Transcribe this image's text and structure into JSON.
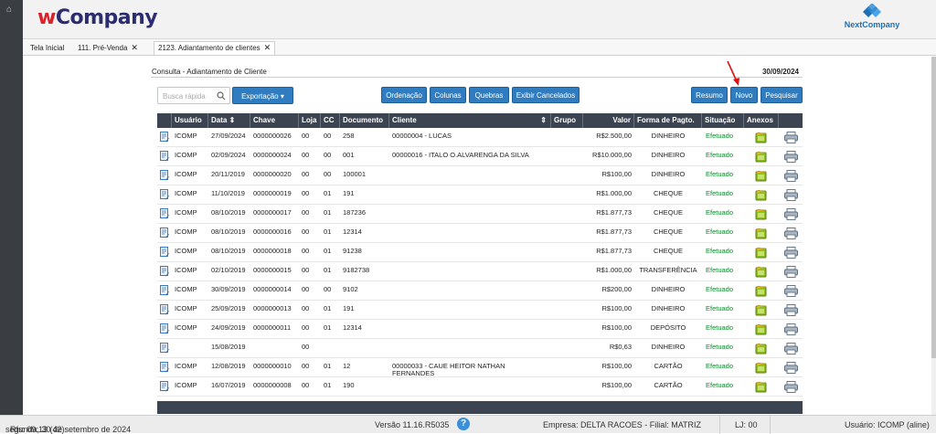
{
  "app": {
    "brand_w": "w",
    "brand_rest": "Company",
    "partner": "NextCompany"
  },
  "tabs": [
    {
      "label": "Tela Inicial",
      "closable": false
    },
    {
      "label": "111. Pré-Venda",
      "closable": true
    },
    {
      "label": "2123. Adiantamento de clientes",
      "closable": true,
      "active": true
    }
  ],
  "panel": {
    "title": "Consulta - Adiantamento de Cliente",
    "date": "30/09/2024"
  },
  "toolbar": {
    "search_placeholder": "Busca rápida",
    "export": "Exportação",
    "order": "Ordenação",
    "columns": "Colunas",
    "breaks": "Quebras",
    "show_cancelled": "Exibir Cancelados",
    "summary": "Resumo",
    "new": "Novo",
    "search": "Pesquisar"
  },
  "columns": [
    "Usuário",
    "Data",
    "Chave",
    "Loja",
    "CC",
    "Documento",
    "Cliente",
    "Grupo",
    "Valor",
    "Forma de Pagto.",
    "Situação",
    "Anexos"
  ],
  "rows": [
    {
      "user": "ICOMP",
      "date": "27/09/2024",
      "key": "0000000026",
      "store": "00",
      "cc": "00",
      "doc": "258",
      "client": "00000004 - LUCAS",
      "client2": "",
      "value": "R$2.500,00",
      "pay": "DINHEIRO",
      "status": "Efetuado"
    },
    {
      "user": "ICOMP",
      "date": "02/09/2024",
      "key": "0000000024",
      "store": "00",
      "cc": "00",
      "doc": "001",
      "client": "00000016 - ITALO O.ALVARENGA DA SILVA",
      "client2": "",
      "value": "R$10.000,00",
      "pay": "DINHEIRO",
      "status": "Efetuado"
    },
    {
      "user": "ICOMP",
      "date": "20/11/2019",
      "key": "0000000020",
      "store": "00",
      "cc": "00",
      "doc": "100001",
      "client": "",
      "client2": "",
      "value": "R$100,00",
      "pay": "DINHEIRO",
      "status": "Efetuado"
    },
    {
      "user": "ICOMP",
      "date": "11/10/2019",
      "key": "0000000019",
      "store": "00",
      "cc": "01",
      "doc": "191",
      "client": "",
      "client2": "",
      "value": "R$1.000,00",
      "pay": "CHEQUE",
      "status": "Efetuado"
    },
    {
      "user": "ICOMP",
      "date": "08/10/2019",
      "key": "0000000017",
      "store": "00",
      "cc": "01",
      "doc": "187236",
      "client": "",
      "client2": "",
      "value": "R$1.877,73",
      "pay": "CHEQUE",
      "status": "Efetuado"
    },
    {
      "user": "ICOMP",
      "date": "08/10/2019",
      "key": "0000000016",
      "store": "00",
      "cc": "01",
      "doc": "12314",
      "client": "",
      "client2": "",
      "value": "R$1.877,73",
      "pay": "CHEQUE",
      "status": "Efetuado"
    },
    {
      "user": "ICOMP",
      "date": "08/10/2019",
      "key": "0000000018",
      "store": "00",
      "cc": "01",
      "doc": "91238",
      "client": "",
      "client2": "",
      "value": "R$1.877,73",
      "pay": "CHEQUE",
      "status": "Efetuado"
    },
    {
      "user": "ICOMP",
      "date": "02/10/2019",
      "key": "0000000015",
      "store": "00",
      "cc": "01",
      "doc": "9182738",
      "client": "",
      "client2": "",
      "value": "R$1.000,00",
      "pay": "TRANSFERÊNCIA",
      "status": "Efetuado"
    },
    {
      "user": "ICOMP",
      "date": "30/09/2019",
      "key": "0000000014",
      "store": "00",
      "cc": "00",
      "doc": "9102",
      "client": "",
      "client2": "",
      "value": "R$200,00",
      "pay": "DINHEIRO",
      "status": "Efetuado"
    },
    {
      "user": "ICOMP",
      "date": "25/09/2019",
      "key": "0000000013",
      "store": "00",
      "cc": "01",
      "doc": "191",
      "client": "",
      "client2": "",
      "value": "R$100,00",
      "pay": "DINHEIRO",
      "status": "Efetuado"
    },
    {
      "user": "ICOMP",
      "date": "24/09/2019",
      "key": "0000000011",
      "store": "00",
      "cc": "01",
      "doc": "12314",
      "client": "",
      "client2": "",
      "value": "R$100,00",
      "pay": "DEPÓSITO",
      "status": "Efetuado"
    },
    {
      "user": "",
      "date": "15/08/2019",
      "key": "",
      "store": "00",
      "cc": "",
      "doc": "",
      "client": "",
      "client2": "",
      "value": "R$0,63",
      "pay": "DINHEIRO",
      "status": "Efetuado"
    },
    {
      "user": "ICOMP",
      "date": "12/08/2019",
      "key": "0000000010",
      "store": "00",
      "cc": "01",
      "doc": "12",
      "client": "00000033 - CAUE HEITOR NATHAN",
      "client2": "FERNANDES",
      "value": "R$100,00",
      "pay": "CARTÃO",
      "status": "Efetuado"
    },
    {
      "user": "ICOMP",
      "date": "16/07/2019",
      "key": "0000000008",
      "store": "00",
      "cc": "01",
      "doc": "190",
      "client": "",
      "client2": "",
      "value": "R$100,00",
      "pay": "CARTÃO",
      "status": "Efetuado"
    }
  ],
  "status": {
    "date": "segunda, 30 de setembro de 2024",
    "rfs": "Rfs: 09:13 (42)",
    "version": "Versão 11.16.R5035",
    "help": "?",
    "company": "Empresa: DELTA RACOES - Filial: MATRIZ",
    "lj": "LJ: 00",
    "user": "Usuário: ICOMP (aline)"
  },
  "colors": {
    "primary_button": "#2f7dc0",
    "grid_header": "#3c4452",
    "ok": "#0a8a2a",
    "annotation_arrow": "#e01010"
  }
}
